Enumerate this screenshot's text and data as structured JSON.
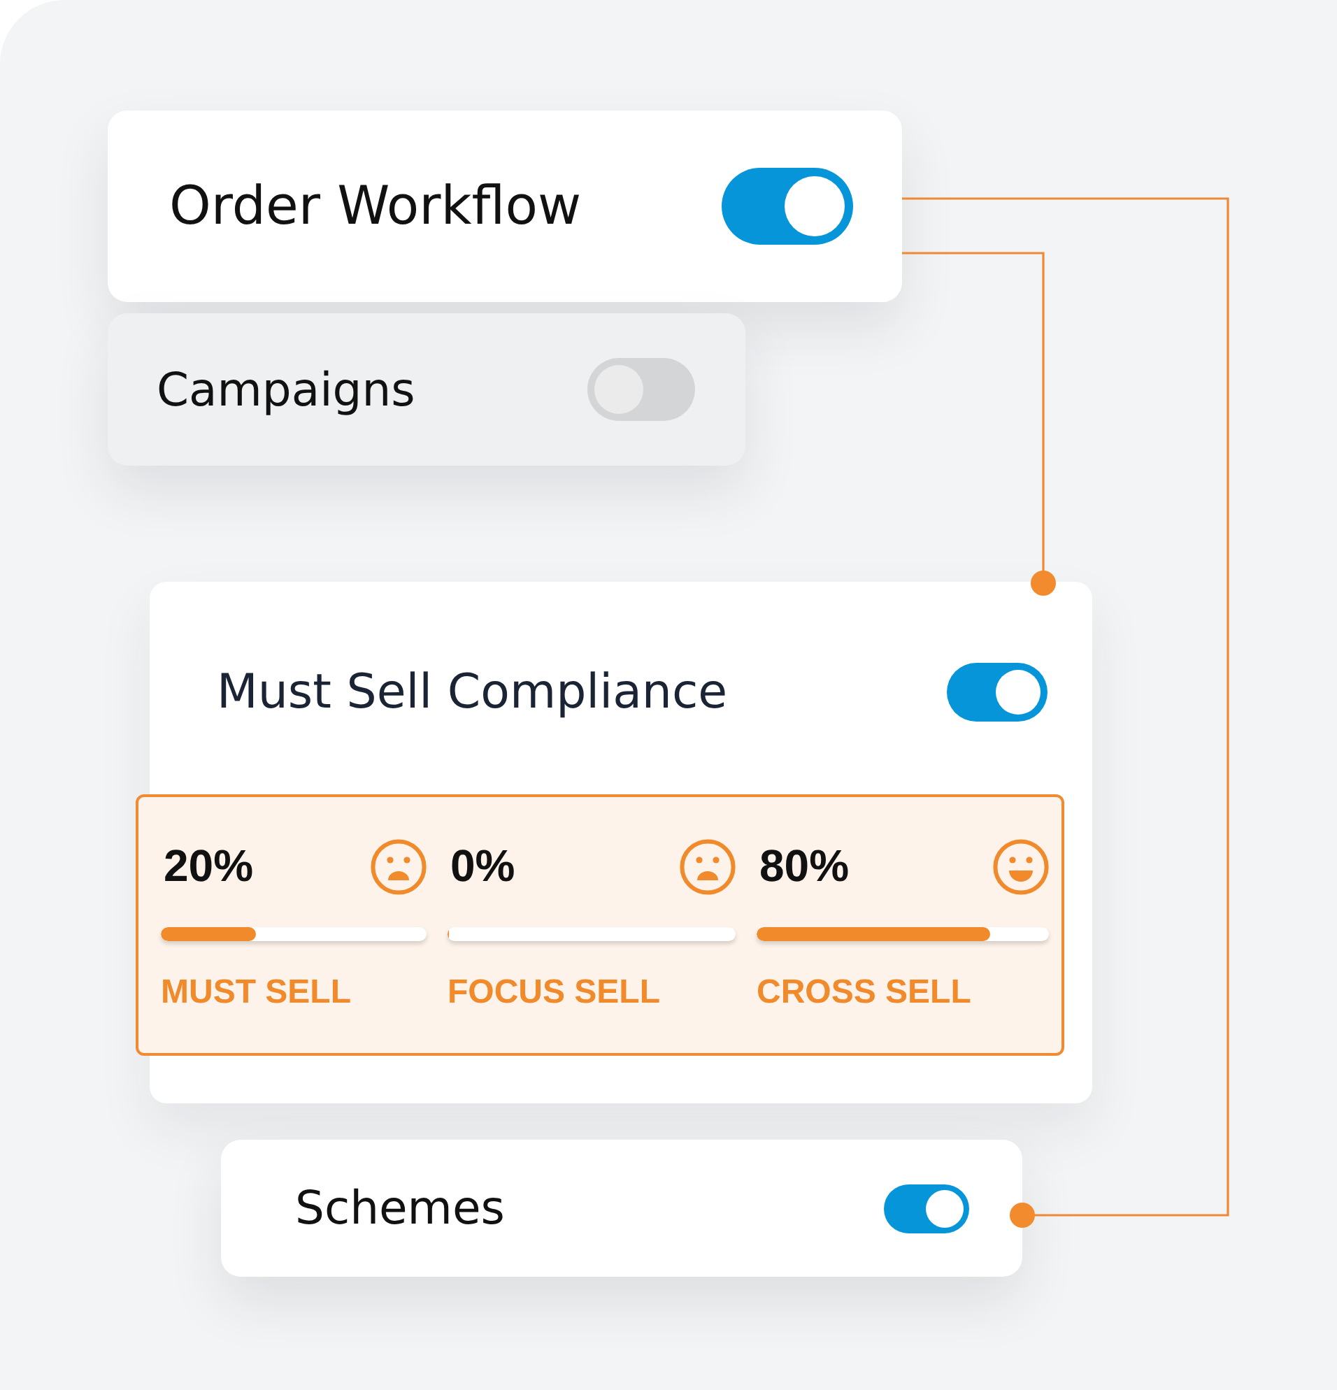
{
  "cards": [
    {
      "kind": "toggle",
      "label": "Order Workflow",
      "on": true
    },
    {
      "kind": "toggle",
      "label": "Campaigns",
      "on": false
    },
    {
      "kind": "compliance",
      "label": "Must Sell Compliance",
      "on": true,
      "metrics": [
        {
          "value": "20%",
          "level": 0.36,
          "label": "MUST SELL"
        },
        {
          "value": "0%",
          "level": 0,
          "label": "FOCUS SELL"
        },
        {
          "value": "80%",
          "level": 0.8,
          "label": "CROSS SELL"
        }
      ]
    },
    {
      "kind": "toggle",
      "label": "Schemes",
      "on": true
    }
  ]
}
